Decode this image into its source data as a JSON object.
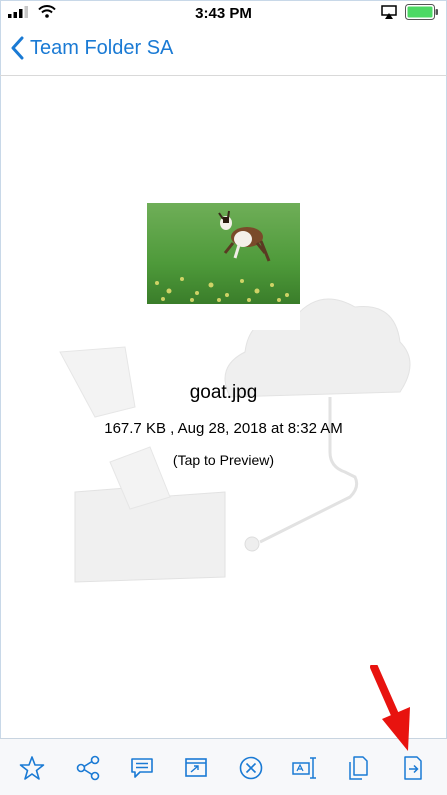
{
  "status_bar": {
    "time": "3:43 PM",
    "battery_color": "#4cd964"
  },
  "nav": {
    "back_label": "Team Folder SA",
    "accent_color": "#1a7ad4"
  },
  "file": {
    "thumbnail": "goat-photo",
    "name": "goat.jpg",
    "meta": "167.7 KB , Aug 28, 2018 at 8:32 AM",
    "preview_hint": "(Tap to Preview)"
  },
  "toolbar": {
    "icons": [
      "star-icon",
      "share-icon",
      "comment-icon",
      "open-in-icon",
      "delete-icon",
      "rename-icon",
      "copy-icon",
      "move-icon"
    ]
  },
  "annotation": {
    "arrow_color": "#e8130f"
  }
}
